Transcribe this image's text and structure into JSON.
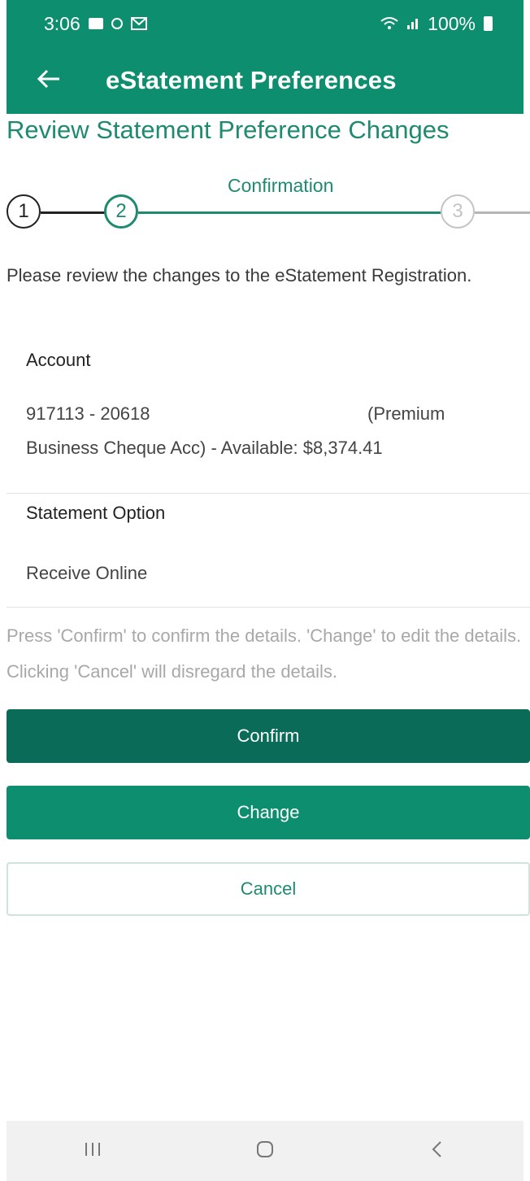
{
  "status_bar": {
    "time": "3:06",
    "battery": "100%",
    "icons": [
      "gallery-icon",
      "circle-icon",
      "mail-icon",
      "wifi-icon",
      "signal-icon",
      "battery-icon"
    ]
  },
  "app_bar": {
    "title": "eStatement Preferences",
    "back_icon": "arrow-left-icon"
  },
  "page": {
    "heading": "Review Statement Preference Changes"
  },
  "stepper": {
    "current_label": "Confirmation",
    "steps": [
      "1",
      "2",
      "3"
    ],
    "current_step": 2
  },
  "intro_text": "Please review the changes to the eStatement Registration.",
  "account": {
    "label": "Account",
    "number": "917113 - 20618",
    "type_prefix": "(Premium",
    "line2": "Business Cheque Acc) - Available: $8,374.41"
  },
  "statement_option": {
    "label": "Statement Option",
    "value": "Receive Online"
  },
  "hint_text": "Press 'Confirm' to confirm the details. 'Change' to edit the details. Clicking 'Cancel' will disregard the details.",
  "buttons": {
    "confirm": "Confirm",
    "change": "Change",
    "cancel": "Cancel"
  },
  "nav_bar": {
    "icons": [
      "recent-apps-icon",
      "home-icon",
      "back-icon"
    ]
  },
  "colors": {
    "primary": "#0d8f6f",
    "primary_dark": "#0a6c58",
    "accent_text": "#1f8a70",
    "hint_text": "#a8a8a8"
  }
}
